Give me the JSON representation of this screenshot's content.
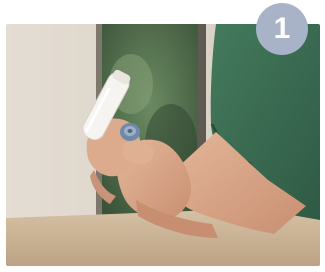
{
  "step": {
    "number": "1",
    "badge_color": "#a9b3c8"
  },
  "photo": {
    "colors": {
      "wall": "#ddd5ca",
      "window_foliage": "#4f6a4e",
      "table": "#c9b396",
      "shirt": "#3b6b52",
      "skin": "#d9a88a",
      "device": "#f3f1ed",
      "cap": "#6f8aa8"
    }
  }
}
